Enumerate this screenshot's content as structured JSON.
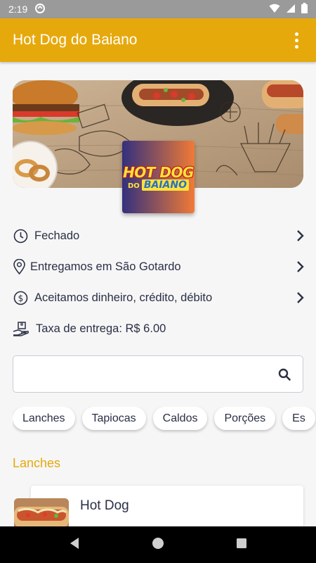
{
  "status_bar": {
    "time": "2:19"
  },
  "app_bar": {
    "title": "Hot Dog do Baiano",
    "menu_icon": "more-vert-icon"
  },
  "store": {
    "logo_line1": "HOT DOG",
    "logo_do": "DO",
    "logo_baiano": "BAIANO"
  },
  "info": {
    "status": "Fechado",
    "delivery_area": "Entregamos em São Gotardo",
    "payment": "Aceitamos dinheiro, crédito, débito",
    "delivery_fee": "Taxa de entrega: R$ 6.00"
  },
  "search": {
    "value": "",
    "placeholder": ""
  },
  "categories": [
    "Lanches",
    "Tapiocas",
    "Caldos",
    "Porções",
    "Es"
  ],
  "section": {
    "title": "Lanches"
  },
  "products": [
    {
      "name": "Hot Dog"
    }
  ],
  "colors": {
    "accent": "#e6a90c",
    "text": "#2a2f45",
    "background": "#f6f6f6"
  }
}
